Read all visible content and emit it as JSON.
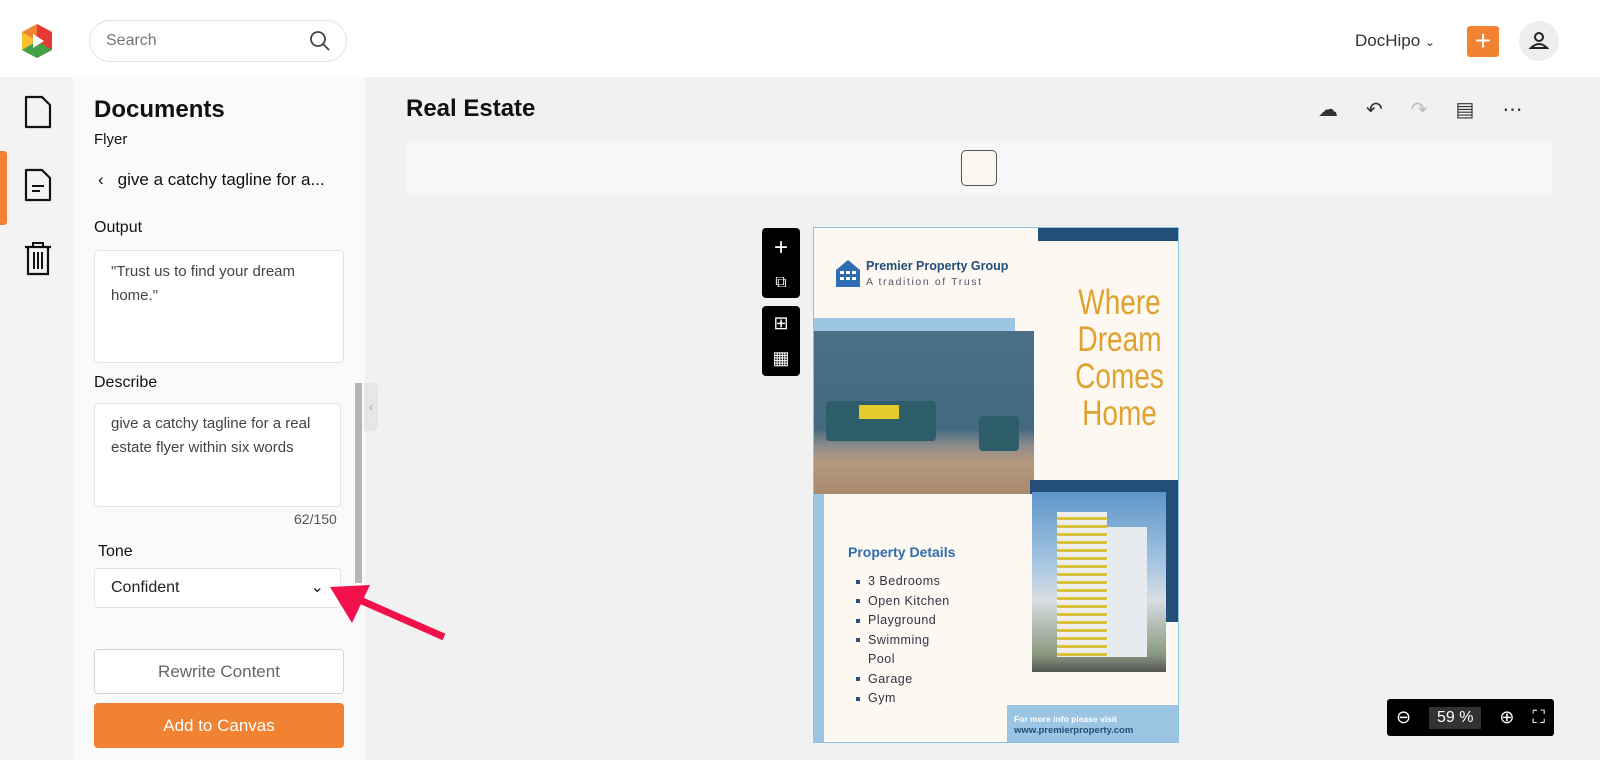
{
  "header": {
    "search_placeholder": "Search",
    "account": "DocHipo"
  },
  "panel": {
    "title": "Documents",
    "subtitle": "Flyer",
    "back_label": "give a catchy tagline for a...",
    "output_label": "Output",
    "output_value": "\"Trust us to find your dream home.\"",
    "describe_label": "Describe",
    "describe_value": "give a catchy tagline for a real estate flyer within six words",
    "char_count": "62/150",
    "tone_label": "Tone",
    "tone_value": "Confident",
    "rewrite_label": "Rewrite Content",
    "add_label": "Add to Canvas"
  },
  "editor": {
    "title": "Real Estate",
    "zoom": "59",
    "zoom_unit": "%"
  },
  "flyer": {
    "company": "Premier Property Group",
    "tagline_small": "A tradition of Trust",
    "headline": [
      "Where",
      "Dream",
      "Comes",
      "Home"
    ],
    "details_title": "Property Details",
    "details": [
      "3 Bedrooms",
      "Open Kitchen",
      "Playground",
      "Swimming",
      "Pool",
      "Garage",
      "Gym"
    ],
    "footer_line1": "For more info please visit",
    "footer_line2": "www.premierproperty.com"
  },
  "colors": {
    "accent": "#f08232",
    "headline": "#e0a22e",
    "navy": "#234e78",
    "light_blue": "#9cc5e4"
  }
}
